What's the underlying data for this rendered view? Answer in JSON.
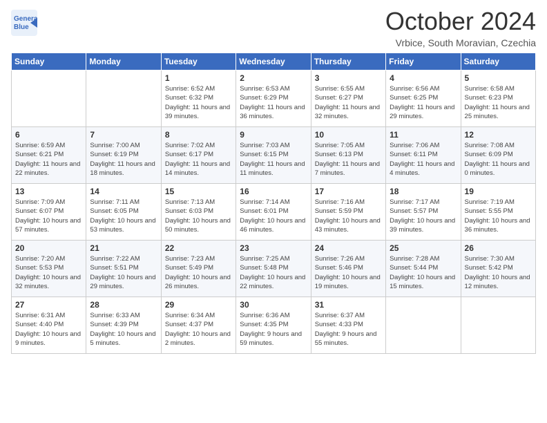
{
  "header": {
    "logo_line1": "General",
    "logo_line2": "Blue",
    "month": "October 2024",
    "location": "Vrbice, South Moravian, Czechia"
  },
  "days_of_week": [
    "Sunday",
    "Monday",
    "Tuesday",
    "Wednesday",
    "Thursday",
    "Friday",
    "Saturday"
  ],
  "weeks": [
    [
      {
        "num": "",
        "info": ""
      },
      {
        "num": "",
        "info": ""
      },
      {
        "num": "1",
        "info": "Sunrise: 6:52 AM\nSunset: 6:32 PM\nDaylight: 11 hours and 39 minutes."
      },
      {
        "num": "2",
        "info": "Sunrise: 6:53 AM\nSunset: 6:29 PM\nDaylight: 11 hours and 36 minutes."
      },
      {
        "num": "3",
        "info": "Sunrise: 6:55 AM\nSunset: 6:27 PM\nDaylight: 11 hours and 32 minutes."
      },
      {
        "num": "4",
        "info": "Sunrise: 6:56 AM\nSunset: 6:25 PM\nDaylight: 11 hours and 29 minutes."
      },
      {
        "num": "5",
        "info": "Sunrise: 6:58 AM\nSunset: 6:23 PM\nDaylight: 11 hours and 25 minutes."
      }
    ],
    [
      {
        "num": "6",
        "info": "Sunrise: 6:59 AM\nSunset: 6:21 PM\nDaylight: 11 hours and 22 minutes."
      },
      {
        "num": "7",
        "info": "Sunrise: 7:00 AM\nSunset: 6:19 PM\nDaylight: 11 hours and 18 minutes."
      },
      {
        "num": "8",
        "info": "Sunrise: 7:02 AM\nSunset: 6:17 PM\nDaylight: 11 hours and 14 minutes."
      },
      {
        "num": "9",
        "info": "Sunrise: 7:03 AM\nSunset: 6:15 PM\nDaylight: 11 hours and 11 minutes."
      },
      {
        "num": "10",
        "info": "Sunrise: 7:05 AM\nSunset: 6:13 PM\nDaylight: 11 hours and 7 minutes."
      },
      {
        "num": "11",
        "info": "Sunrise: 7:06 AM\nSunset: 6:11 PM\nDaylight: 11 hours and 4 minutes."
      },
      {
        "num": "12",
        "info": "Sunrise: 7:08 AM\nSunset: 6:09 PM\nDaylight: 11 hours and 0 minutes."
      }
    ],
    [
      {
        "num": "13",
        "info": "Sunrise: 7:09 AM\nSunset: 6:07 PM\nDaylight: 10 hours and 57 minutes."
      },
      {
        "num": "14",
        "info": "Sunrise: 7:11 AM\nSunset: 6:05 PM\nDaylight: 10 hours and 53 minutes."
      },
      {
        "num": "15",
        "info": "Sunrise: 7:13 AM\nSunset: 6:03 PM\nDaylight: 10 hours and 50 minutes."
      },
      {
        "num": "16",
        "info": "Sunrise: 7:14 AM\nSunset: 6:01 PM\nDaylight: 10 hours and 46 minutes."
      },
      {
        "num": "17",
        "info": "Sunrise: 7:16 AM\nSunset: 5:59 PM\nDaylight: 10 hours and 43 minutes."
      },
      {
        "num": "18",
        "info": "Sunrise: 7:17 AM\nSunset: 5:57 PM\nDaylight: 10 hours and 39 minutes."
      },
      {
        "num": "19",
        "info": "Sunrise: 7:19 AM\nSunset: 5:55 PM\nDaylight: 10 hours and 36 minutes."
      }
    ],
    [
      {
        "num": "20",
        "info": "Sunrise: 7:20 AM\nSunset: 5:53 PM\nDaylight: 10 hours and 32 minutes."
      },
      {
        "num": "21",
        "info": "Sunrise: 7:22 AM\nSunset: 5:51 PM\nDaylight: 10 hours and 29 minutes."
      },
      {
        "num": "22",
        "info": "Sunrise: 7:23 AM\nSunset: 5:49 PM\nDaylight: 10 hours and 26 minutes."
      },
      {
        "num": "23",
        "info": "Sunrise: 7:25 AM\nSunset: 5:48 PM\nDaylight: 10 hours and 22 minutes."
      },
      {
        "num": "24",
        "info": "Sunrise: 7:26 AM\nSunset: 5:46 PM\nDaylight: 10 hours and 19 minutes."
      },
      {
        "num": "25",
        "info": "Sunrise: 7:28 AM\nSunset: 5:44 PM\nDaylight: 10 hours and 15 minutes."
      },
      {
        "num": "26",
        "info": "Sunrise: 7:30 AM\nSunset: 5:42 PM\nDaylight: 10 hours and 12 minutes."
      }
    ],
    [
      {
        "num": "27",
        "info": "Sunrise: 6:31 AM\nSunset: 4:40 PM\nDaylight: 10 hours and 9 minutes."
      },
      {
        "num": "28",
        "info": "Sunrise: 6:33 AM\nSunset: 4:39 PM\nDaylight: 10 hours and 5 minutes."
      },
      {
        "num": "29",
        "info": "Sunrise: 6:34 AM\nSunset: 4:37 PM\nDaylight: 10 hours and 2 minutes."
      },
      {
        "num": "30",
        "info": "Sunrise: 6:36 AM\nSunset: 4:35 PM\nDaylight: 9 hours and 59 minutes."
      },
      {
        "num": "31",
        "info": "Sunrise: 6:37 AM\nSunset: 4:33 PM\nDaylight: 9 hours and 55 minutes."
      },
      {
        "num": "",
        "info": ""
      },
      {
        "num": "",
        "info": ""
      }
    ]
  ]
}
